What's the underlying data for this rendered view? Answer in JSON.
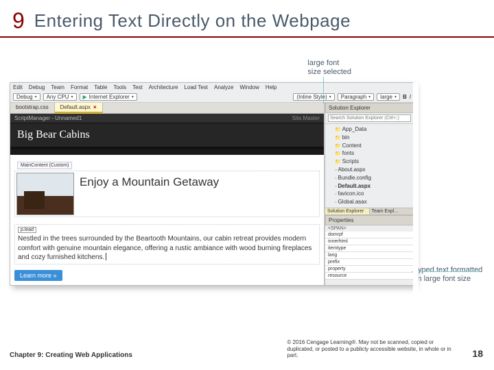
{
  "header": {
    "chapter_number": "9",
    "title": "Entering Text Directly on the Webpage"
  },
  "callouts": {
    "top_line1": "large font",
    "top_line2": "size selected",
    "right_line1": "typed text formatted",
    "right_line2": "in large font size"
  },
  "ide": {
    "menubar": [
      "Edit",
      "Debug",
      "Team",
      "Format",
      "Table",
      "Tools",
      "Test",
      "Architecture",
      "Load Test",
      "Analyze",
      "Window",
      "Help"
    ],
    "toolbar": {
      "config": "Debug",
      "cpu": "Any CPU",
      "browser": "Internet Explorer",
      "style": "(Inline Style)",
      "tag": "Paragraph",
      "size": "large"
    },
    "tabs": [
      {
        "label": "bootstrap.css",
        "active": false
      },
      {
        "label": "Default.aspx",
        "active": true,
        "closeable": true
      }
    ],
    "scriptbar_left": "ScriptManager",
    "scriptbar_right": "Unnamed1",
    "brand": "Big Bear Cabins",
    "tagline": "MainContent (Custom)",
    "hero_heading": "Enjoy a Mountain Getaway",
    "lead_label": "p.lead",
    "lead_text": "Nestled in the trees surrounded by the Beartooth Mountains, our cabin retreat provides modern comfort with genuine mountain elegance, offering a rustic ambiance with wood burning fireplaces and cozy furnished kitchens.",
    "learn_more": "Learn more »",
    "site_master": "Site.Master"
  },
  "solution_explorer": {
    "title": "Solution Explorer",
    "search_placeholder": "Search Solution Explorer (Ctrl+;)",
    "items": [
      {
        "label": "App_Data",
        "kind": "fld",
        "ind": 1
      },
      {
        "label": "bin",
        "kind": "fld",
        "ind": 1
      },
      {
        "label": "Content",
        "kind": "fld",
        "ind": 1
      },
      {
        "label": "fonts",
        "kind": "fld",
        "ind": 1
      },
      {
        "label": "Scripts",
        "kind": "fld",
        "ind": 1
      },
      {
        "label": "About.aspx",
        "kind": "fil",
        "ind": 1
      },
      {
        "label": "Bundle.config",
        "kind": "fil",
        "ind": 1
      },
      {
        "label": "Default.aspx",
        "kind": "fil",
        "ind": 1,
        "bold": true
      },
      {
        "label": "favicon.ico",
        "kind": "fil",
        "ind": 1
      },
      {
        "label": "Global.asax",
        "kind": "fil",
        "ind": 1
      }
    ],
    "tabs": [
      "Solution Explorer",
      "Team Expl…"
    ]
  },
  "properties": {
    "title": "Properties",
    "subject": "<SPAN>",
    "rows": [
      "domrpf",
      "innerhtml",
      "itemtype",
      "lang",
      "prefix",
      "property",
      "resource"
    ]
  },
  "footer": {
    "chapter": "Chapter 9: Creating Web Applications",
    "copyright": "© 2016 Cengage Learning®. May not be scanned, copied or duplicated, or posted to a publicly accessible website, in whole or in part.",
    "page": "18"
  }
}
